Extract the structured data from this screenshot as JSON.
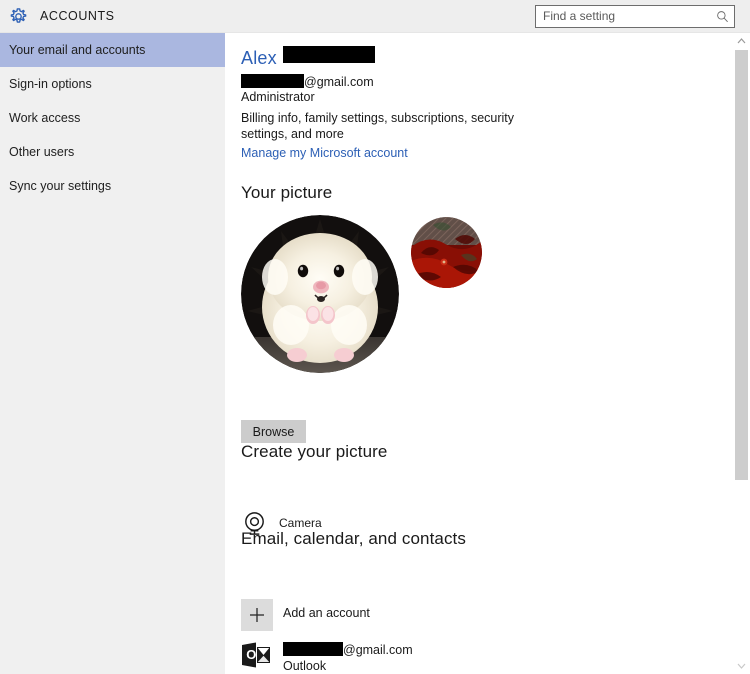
{
  "header": {
    "title": "ACCOUNTS",
    "gear_icon": "gear-icon",
    "search": {
      "placeholder": "Find a setting",
      "value": "",
      "icon": "search-icon"
    }
  },
  "sidebar": {
    "items": [
      {
        "label": "Your email and accounts",
        "selected": true
      },
      {
        "label": "Sign-in options",
        "selected": false
      },
      {
        "label": "Work access",
        "selected": false
      },
      {
        "label": "Other users",
        "selected": false
      },
      {
        "label": "Sync your settings",
        "selected": false
      }
    ]
  },
  "account": {
    "display_name": "Alex",
    "display_name_redacted": true,
    "email_suffix": "@gmail.com",
    "email_redacted": true,
    "role": "Administrator",
    "description": "Billing info, family settings, subscriptions, security settings, and more",
    "manage_link": "Manage my Microsoft account"
  },
  "your_picture": {
    "title": "Your picture",
    "current_avatar": "hamster-photo",
    "alternate_avatar": "red-abstract-photo",
    "browse_label": "Browse"
  },
  "create_picture": {
    "title": "Create your picture",
    "camera": {
      "label": "Camera",
      "icon": "camera-icon"
    }
  },
  "email_calendar_contacts": {
    "title": "Email, calendar, and contacts",
    "add_account_label": "Add an account",
    "add_account_icon": "plus-icon",
    "accounts": [
      {
        "email_suffix": "@gmail.com",
        "email_redacted": true,
        "provider": "Outlook",
        "icon": "outlook-icon"
      }
    ]
  },
  "scrollbar": {
    "up_icon": "chevron-up-icon",
    "down_icon": "chevron-down-icon"
  },
  "colors": {
    "accent_blue": "#2c5fb5",
    "selected_nav": "#aab7e0",
    "sidebar_bg": "#f0f0f0",
    "header_bg": "#eeeeee",
    "button_bg": "#cccccc",
    "scrollbar_thumb": "#cdcdcd"
  }
}
